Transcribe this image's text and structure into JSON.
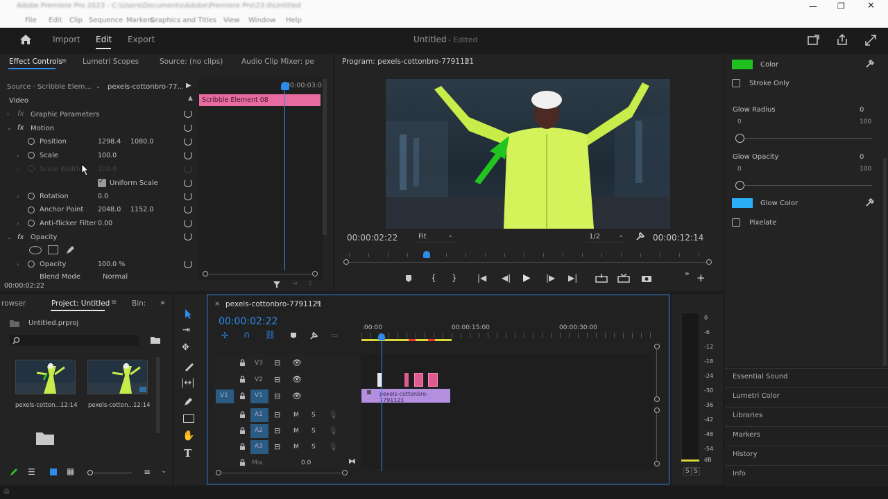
{
  "window": {
    "title": "Adobe Premiere Pro 2023 - C:\\Users\\Documents\\Adobe\\Premiere Pro\\23.0\\Untitled",
    "minimize": "—",
    "maximize": "❐",
    "close": "✕"
  },
  "menu": [
    "File",
    "Edit",
    "Clip",
    "Sequence",
    "Markers",
    "Graphics and Titles",
    "View",
    "Window",
    "Help"
  ],
  "workspace": {
    "import": "Import",
    "edit": "Edit",
    "export": "Export",
    "project_title": "Untitled",
    "edited": "- Edited"
  },
  "effect_controls": {
    "tabs": [
      "Effect Controls",
      "Lumetri Scopes",
      "Source: (no clips)",
      "Audio Clip Mixer: pe"
    ],
    "source": "Source · Scribble Elem...",
    "clip": "pexels-cottonbro-77...",
    "timecode_start": "00:00:03:0",
    "clip_bar": "Scribble Element 08",
    "video_label": "Video",
    "graphic_params": "Graphic Parameters",
    "motion": "Motion",
    "position_label": "Position",
    "position_x": "1298.4",
    "position_y": "1080.0",
    "scale_label": "Scale",
    "scale_value": "100.0",
    "scale_width_label": "Scale Width",
    "scale_width_value": "100.0",
    "uniform_scale": "Uniform Scale",
    "rotation_label": "Rotation",
    "rotation_value": "0.0",
    "anchor_label": "Anchor Point",
    "anchor_x": "2048.0",
    "anchor_y": "1152.0",
    "antiflicker_label": "Anti-flicker Filter",
    "antiflicker_value": "0.00",
    "opacity_section": "Opacity",
    "opacity_label": "Opacity",
    "opacity_value": "100.0 %",
    "blend_label": "Blend Mode",
    "blend_value": "Normal",
    "footer_timecode": "00:00:02:22"
  },
  "program": {
    "title": "Program: pexels-cottonbro-7791121",
    "timecode": "00:00:02:22",
    "fit": "Fit",
    "resolution": "1/2",
    "duration": "00:00:12:14"
  },
  "essential_graphics": {
    "color_label": "Color",
    "color_hex": "#1fc01f",
    "stroke_only": "Stroke Only",
    "glow_radius_label": "Glow Radius",
    "glow_radius_value": "0",
    "glow_radius_min": "0",
    "glow_radius_max": "100",
    "glow_opacity_label": "Glow Opacity",
    "glow_opacity_value": "0",
    "glow_opacity_min": "0",
    "glow_opacity_max": "100",
    "glow_color_label": "Glow Color",
    "glow_color_hex": "#2aaef5",
    "pixelate": "Pixelate",
    "panels": [
      "Essential Sound",
      "Lumetri Color",
      "Libraries",
      "Markers",
      "History",
      "Info"
    ]
  },
  "project": {
    "tabs": [
      "rowser",
      "Project: Untitled",
      "Bin:"
    ],
    "file": "Untitled.prproj",
    "items": [
      {
        "name": "pexels-cotton...",
        "duration": "12:14"
      },
      {
        "name": "pexels-cotton...",
        "duration": "12:14"
      }
    ]
  },
  "timeline": {
    "tab": "pexels-cottonbro-7791121",
    "timecode": "00:00:02:22",
    "ruler": [
      ":00:00",
      "00:00:15:00",
      "00:00:30:00"
    ],
    "video_tracks": [
      "V3",
      "V2",
      "V1"
    ],
    "audio_tracks": [
      "A1",
      "A2",
      "A3"
    ],
    "source_v1": "V1",
    "mix_label": "Mix",
    "mix_value": "0.0",
    "clip_v1": "pexels-cottonbro-7791121",
    "m": "M",
    "s": "S"
  },
  "audio_meter": {
    "labels": [
      "0",
      "-6",
      "-12",
      "-18",
      "-24",
      "-30",
      "-36",
      "-42",
      "-48",
      "-54",
      "dB"
    ],
    "solo_l": "S",
    "solo_r": "S"
  }
}
